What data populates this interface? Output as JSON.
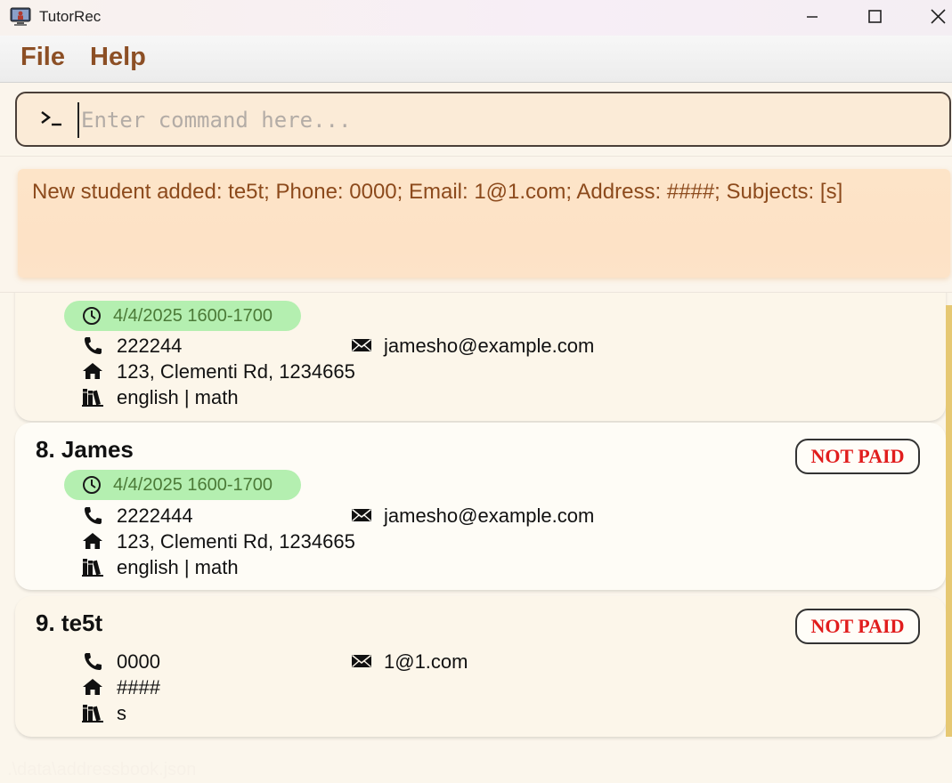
{
  "window": {
    "title": "TutorRec",
    "icons": [
      "app-icon",
      "minimize-icon",
      "maximize-icon",
      "close-icon"
    ]
  },
  "menu": {
    "items": [
      {
        "label": "File"
      },
      {
        "label": "Help"
      }
    ]
  },
  "command": {
    "placeholder": "Enter command here...",
    "value": "",
    "icon": "terminal-prompt-icon"
  },
  "result": {
    "text": "New student added: te5t; Phone: 0000; Email: 1@1.com; Address: ####; Subjects: [s]"
  },
  "students": [
    {
      "name": "",
      "session": "4/4/2025 1600-1700",
      "phone": "222244",
      "email": "jamesho@example.com",
      "address": "123, Clementi Rd, 1234665",
      "subjects": "english | math"
    },
    {
      "name": "8. James",
      "payment": "NOT PAID",
      "session": "4/4/2025 1600-1700",
      "phone": "2222444",
      "email": "jamesho@example.com",
      "address": "123, Clementi Rd, 1234665",
      "subjects": "english | math"
    },
    {
      "name": "9. te5t",
      "payment": "NOT PAID",
      "phone": "0000",
      "email": "1@1.com",
      "address": "####",
      "subjects": "s"
    }
  ],
  "status": {
    "path": ".\\data\\addressbook.json"
  },
  "colors": {
    "menu_text": "#8c4f25",
    "result_bg": "#fde4c8",
    "session_bg": "#b4efb0",
    "not_paid": "#e11d1d",
    "scroll_thumb": "#e6c873"
  }
}
